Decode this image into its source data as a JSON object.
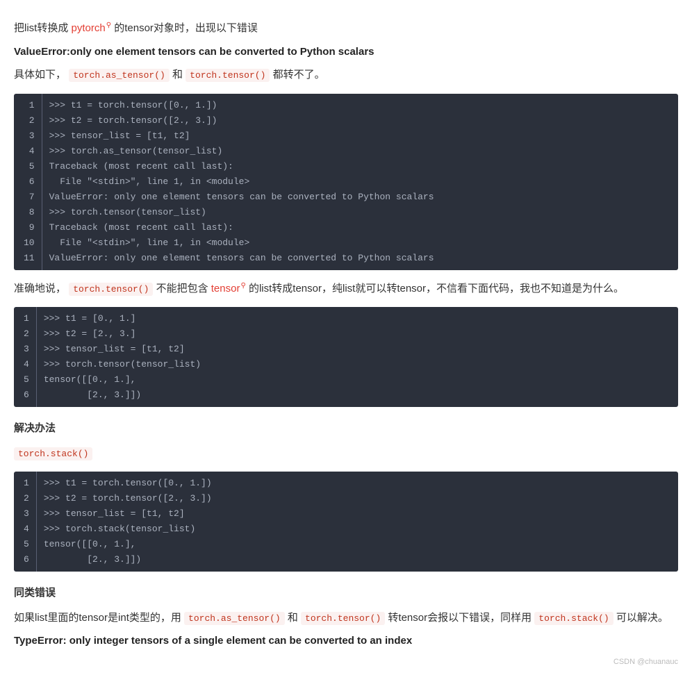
{
  "intro": {
    "part1": "把list转换成",
    "link1": "pytorch",
    "part2": "的tensor对象时，出现以下错误"
  },
  "error1": "ValueError:only one element tensors can be converted to Python scalars",
  "para2": {
    "part1": "具体如下，",
    "code1": "torch.as_tensor()",
    "part2": "和",
    "code2": "torch.tensor()",
    "part3": "都转不了。"
  },
  "codeblock1": [
    ">>> t1 = torch.tensor([0., 1.])",
    ">>> t2 = torch.tensor([2., 3.])",
    ">>> tensor_list = [t1, t2]",
    ">>> torch.as_tensor(tensor_list)",
    "Traceback (most recent call last):",
    "  File \"<stdin>\", line 1, in <module>",
    "ValueError: only one element tensors can be converted to Python scalars",
    ">>> torch.tensor(tensor_list)",
    "Traceback (most recent call last):",
    "  File \"<stdin>\", line 1, in <module>",
    "ValueError: only one element tensors can be converted to Python scalars"
  ],
  "para3": {
    "part1": "准确地说，",
    "code1": "torch.tensor()",
    "part2": "不能把包含",
    "link1": "tensor",
    "part3": "的list转成tensor，纯list就可以转tensor，不信看下面代码，我也不知道是为什么。"
  },
  "codeblock2": [
    ">>> t1 = [0., 1.]",
    ">>> t2 = [2., 3.]",
    ">>> tensor_list = [t1, t2]",
    ">>> torch.tensor(tensor_list)",
    "tensor([[0., 1.],",
    "        [2., 3.]])"
  ],
  "solution_title": "解决办法",
  "solution_code": "torch.stack()",
  "codeblock3": [
    ">>> t1 = torch.tensor([0., 1.])",
    ">>> t2 = torch.tensor([2., 3.])",
    ">>> tensor_list = [t1, t2]",
    ">>> torch.stack(tensor_list)",
    "tensor([[0., 1.],",
    "        [2., 3.]])"
  ],
  "similar_title": "同类错误",
  "para4": {
    "part1": "如果list里面的tensor是int类型的，用",
    "code1": "torch.as_tensor()",
    "part2": "和",
    "code2": "torch.tensor()",
    "part3": "转tensor会报以下错误，同样用",
    "code3": "torch.stack()",
    "part4": "可以解决。"
  },
  "error2": "TypeError: only integer tensors of a single element can be converted to an index",
  "watermark": "CSDN @chuanauc"
}
